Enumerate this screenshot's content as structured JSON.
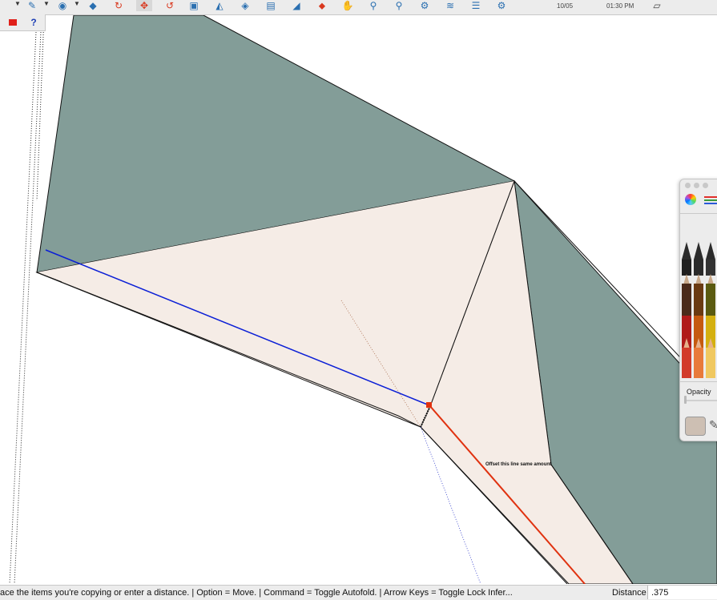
{
  "toolbar": {
    "date": "10/05",
    "time": "01:30 PM",
    "icons": [
      "select-arrow-icon",
      "pencil-icon",
      "circle-icon",
      "push-pull-icon",
      "rotate-icon",
      "move-icon",
      "follow-me-icon",
      "tape-measure-icon",
      "protractor-icon",
      "paint-bucket-icon",
      "section-plane-icon",
      "layout-send-icon",
      "orbit-icon",
      "pan-icon",
      "zoom-icon",
      "zoom-extents-icon",
      "component-icon",
      "sandbox-icon",
      "layers-icon",
      "settings-icon",
      "extension-icon"
    ]
  },
  "leftbar": {
    "icons": [
      "stop-icon",
      "help-icon"
    ],
    "help_glyph": "?"
  },
  "canvas": {
    "annotation": "Offset this line same amount",
    "colors": {
      "roof": "#839d98",
      "face": "#f5ece6",
      "edge": "#111111",
      "blue_axis": "#0b1fd6",
      "red_axis": "#e03210",
      "endpoint": "#e03210"
    }
  },
  "color_panel": {
    "opacity_label": "Opacity",
    "swatch_color": "#cdbfb3"
  },
  "status": {
    "message": "ace the items you're copying or enter a distance. | Option = Move. | Command = Toggle Autofold. | Arrow Keys = Toggle Lock Infer...",
    "distance_label": "Distance",
    "distance_value": ".375"
  }
}
